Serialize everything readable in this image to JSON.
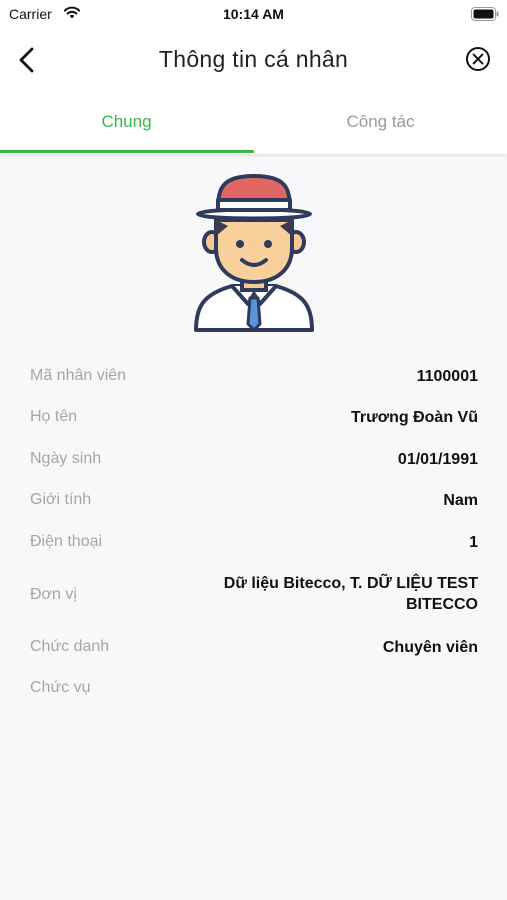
{
  "status_bar": {
    "carrier": "Carrier",
    "time": "10:14 AM"
  },
  "nav": {
    "title": "Thông tin cá nhân",
    "back_icon": "chevron-left-icon",
    "close_icon": "close-circle-icon"
  },
  "tabs": [
    {
      "label": "Chung",
      "active": true
    },
    {
      "label": "Công tác",
      "active": false
    }
  ],
  "colors": {
    "accent": "#3cb54a",
    "label": "#a6a6a6",
    "value": "#111111"
  },
  "profile": {
    "fields": [
      {
        "label": "Mã nhân viên",
        "value": "1100001"
      },
      {
        "label": "Họ tên",
        "value": "Trương Đoàn Vũ"
      },
      {
        "label": "Ngày sinh",
        "value": "01/01/1991"
      },
      {
        "label": "Giới tính",
        "value": "Nam"
      },
      {
        "label": "Điện thoại",
        "value": "1"
      },
      {
        "label": "Đơn vị",
        "value": "Dữ liệu Bitecco, T. DỮ LIỆU TEST BITECCO"
      },
      {
        "label": "Chức danh",
        "value": "Chuyên viên"
      },
      {
        "label": "Chức vụ",
        "value": ""
      }
    ]
  }
}
